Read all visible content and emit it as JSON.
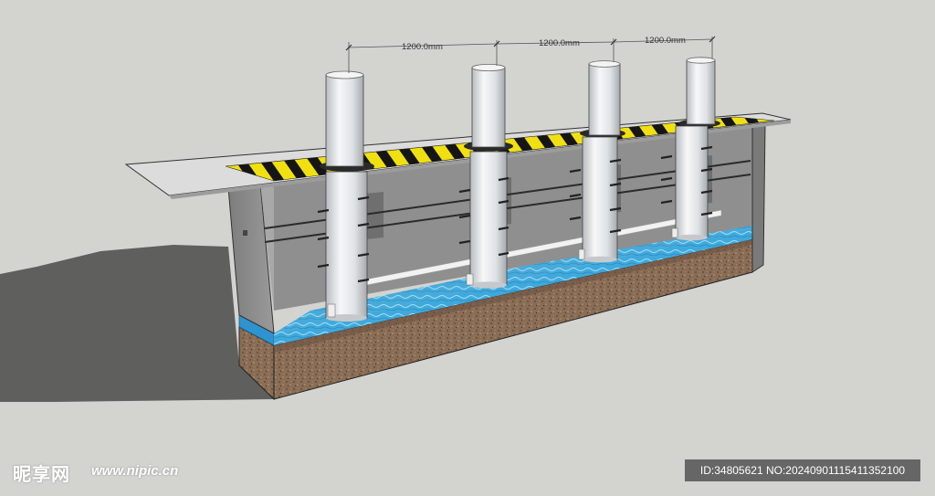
{
  "dimensions": [
    {
      "label": "1200.0mm"
    },
    {
      "label": "1200.0mm"
    },
    {
      "label": "1200.0mm"
    }
  ],
  "pillars_count": 4,
  "colors": {
    "background": "#d3d4d0",
    "warning_yellow": "#f0e010",
    "warning_black": "#151515",
    "concrete_wall": "#8e8e8e",
    "water": "#3fa9dc",
    "soil": "#8a6d55",
    "pillar": "#e8eaec"
  },
  "watermark": {
    "logo_text": "昵享网",
    "url": "www.nipic.cn",
    "id_text": "ID:34805621 NO:20240901115411352100"
  }
}
